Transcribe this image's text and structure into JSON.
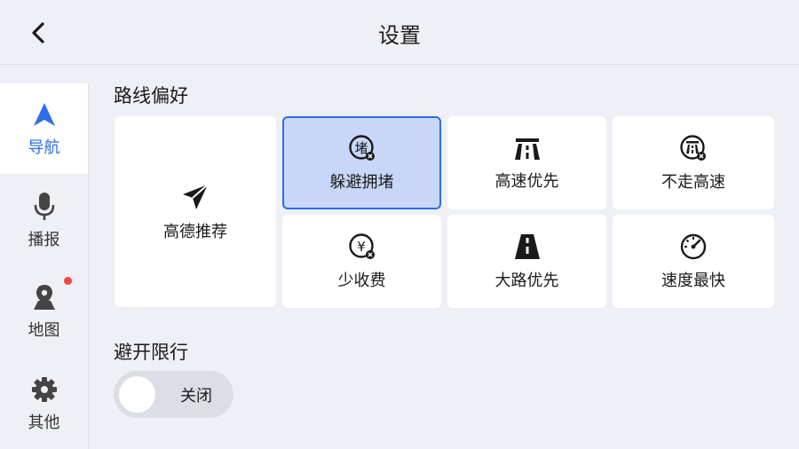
{
  "header": {
    "title": "设置"
  },
  "sidebar": {
    "items": [
      {
        "label": "导航",
        "icon": "navigation-arrow-icon",
        "active": true
      },
      {
        "label": "播报",
        "icon": "microphone-icon",
        "active": false
      },
      {
        "label": "地图",
        "icon": "map-pin-icon",
        "active": false,
        "badge": "red-dot"
      },
      {
        "label": "其他",
        "icon": "gear-icon",
        "active": false
      }
    ]
  },
  "route_preference": {
    "title": "路线偏好",
    "options": [
      {
        "label": "高德推荐",
        "icon": "paper-plane-icon",
        "selected": false
      },
      {
        "label": "躲避拥堵",
        "icon": "avoid-congestion-icon",
        "selected": true
      },
      {
        "label": "高速优先",
        "icon": "highway-icon",
        "selected": false
      },
      {
        "label": "不走高速",
        "icon": "no-highway-icon",
        "selected": false
      },
      {
        "label": "少收费",
        "icon": "less-toll-icon",
        "selected": false
      },
      {
        "label": "大路优先",
        "icon": "main-road-icon",
        "selected": false
      },
      {
        "label": "速度最快",
        "icon": "speedometer-icon",
        "selected": false
      }
    ]
  },
  "avoid_restriction": {
    "title": "避开限行",
    "toggle_label": "关闭",
    "enabled": false
  },
  "colors": {
    "accent": "#2f6de8",
    "selected_bg": "#c8d7f7",
    "background": "#eef0f6",
    "badge": "#f0473e"
  }
}
